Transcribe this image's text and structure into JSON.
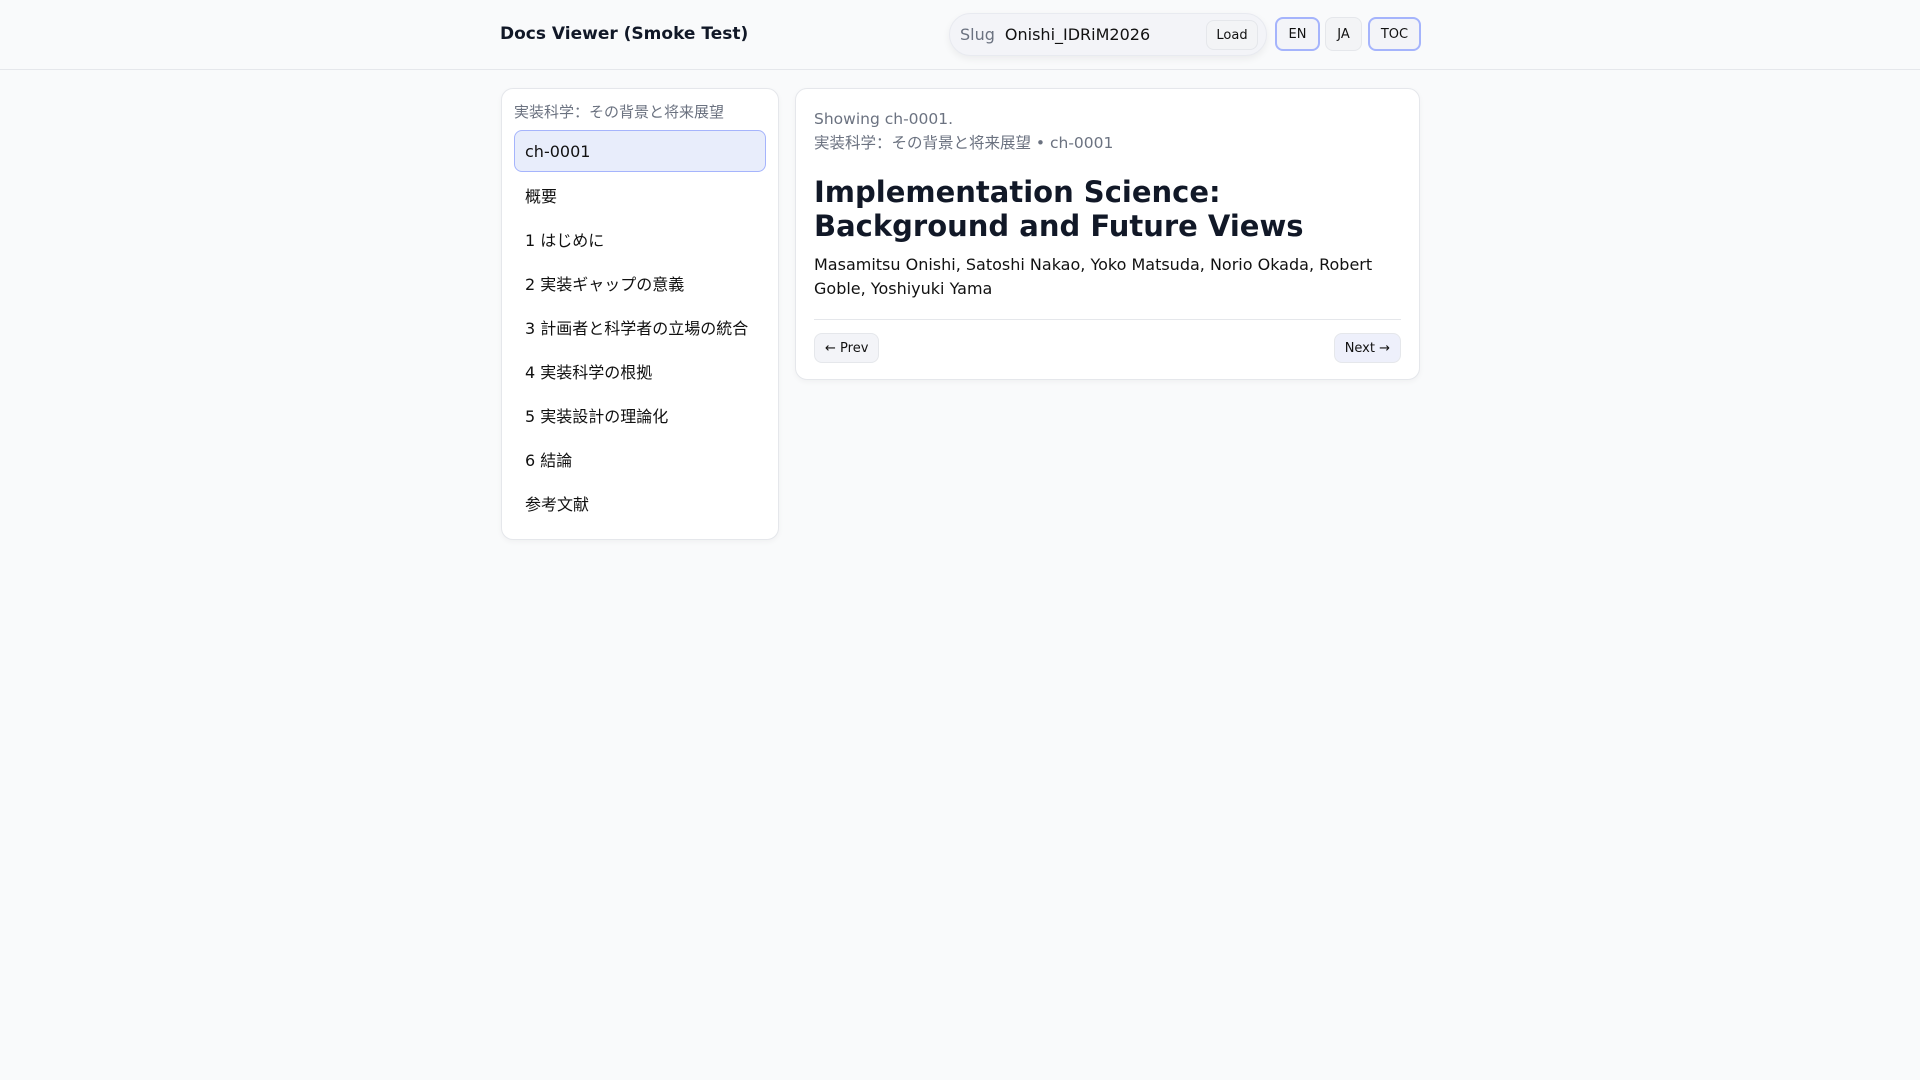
{
  "header": {
    "title": "Docs Viewer (Smoke Test)",
    "slug_label": "Slug",
    "slug_value": "Onishi_IDRiM2026",
    "load": "Load",
    "en": "EN",
    "ja": "JA",
    "toc": "TOC"
  },
  "sidebar": {
    "title": "実装科学：その背景と将来展望",
    "items": [
      "ch-0001",
      "概要",
      "1 はじめに",
      "2 実装ギャップの意義",
      "3 計画者と科学者の立場の統合",
      "4 実装科学の根拠",
      "5 実装設計の理論化",
      "6 結論",
      "参考文献"
    ]
  },
  "main": {
    "status": "Showing ch-0001.",
    "crumb": "実装科学：その背景と将来展望 • ch-0001",
    "title": "Implementation Science: Background and Future Views",
    "authors": "Masamitsu Onishi, Satoshi Nakao, Yoko Matsuda, Norio Okada, Robert Goble, Yoshiyuki Yama",
    "prev": "← Prev",
    "next": "Next →"
  }
}
